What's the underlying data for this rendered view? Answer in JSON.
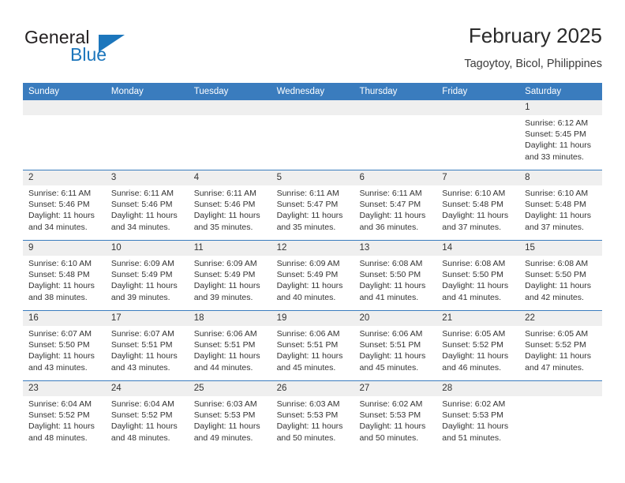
{
  "brand": {
    "name_part1": "General",
    "name_part2": "Blue",
    "accent_color": "#1c76bc",
    "logo_icon": "triangle-logo-icon"
  },
  "header": {
    "title": "February 2025",
    "location": "Tagoytoy, Bicol, Philippines"
  },
  "calendar": {
    "header_bg_color": "#3a7cbe",
    "daynum_band_color": "#efefef",
    "weekdays": [
      "Sunday",
      "Monday",
      "Tuesday",
      "Wednesday",
      "Thursday",
      "Friday",
      "Saturday"
    ],
    "weeks": [
      [
        {
          "day": "",
          "sunrise": "",
          "sunset": "",
          "daylight_line1": "",
          "daylight_line2": ""
        },
        {
          "day": "",
          "sunrise": "",
          "sunset": "",
          "daylight_line1": "",
          "daylight_line2": ""
        },
        {
          "day": "",
          "sunrise": "",
          "sunset": "",
          "daylight_line1": "",
          "daylight_line2": ""
        },
        {
          "day": "",
          "sunrise": "",
          "sunset": "",
          "daylight_line1": "",
          "daylight_line2": ""
        },
        {
          "day": "",
          "sunrise": "",
          "sunset": "",
          "daylight_line1": "",
          "daylight_line2": ""
        },
        {
          "day": "",
          "sunrise": "",
          "sunset": "",
          "daylight_line1": "",
          "daylight_line2": ""
        },
        {
          "day": "1",
          "sunrise": "Sunrise: 6:12 AM",
          "sunset": "Sunset: 5:45 PM",
          "daylight_line1": "Daylight: 11 hours",
          "daylight_line2": "and 33 minutes."
        }
      ],
      [
        {
          "day": "2",
          "sunrise": "Sunrise: 6:11 AM",
          "sunset": "Sunset: 5:46 PM",
          "daylight_line1": "Daylight: 11 hours",
          "daylight_line2": "and 34 minutes."
        },
        {
          "day": "3",
          "sunrise": "Sunrise: 6:11 AM",
          "sunset": "Sunset: 5:46 PM",
          "daylight_line1": "Daylight: 11 hours",
          "daylight_line2": "and 34 minutes."
        },
        {
          "day": "4",
          "sunrise": "Sunrise: 6:11 AM",
          "sunset": "Sunset: 5:46 PM",
          "daylight_line1": "Daylight: 11 hours",
          "daylight_line2": "and 35 minutes."
        },
        {
          "day": "5",
          "sunrise": "Sunrise: 6:11 AM",
          "sunset": "Sunset: 5:47 PM",
          "daylight_line1": "Daylight: 11 hours",
          "daylight_line2": "and 35 minutes."
        },
        {
          "day": "6",
          "sunrise": "Sunrise: 6:11 AM",
          "sunset": "Sunset: 5:47 PM",
          "daylight_line1": "Daylight: 11 hours",
          "daylight_line2": "and 36 minutes."
        },
        {
          "day": "7",
          "sunrise": "Sunrise: 6:10 AM",
          "sunset": "Sunset: 5:48 PM",
          "daylight_line1": "Daylight: 11 hours",
          "daylight_line2": "and 37 minutes."
        },
        {
          "day": "8",
          "sunrise": "Sunrise: 6:10 AM",
          "sunset": "Sunset: 5:48 PM",
          "daylight_line1": "Daylight: 11 hours",
          "daylight_line2": "and 37 minutes."
        }
      ],
      [
        {
          "day": "9",
          "sunrise": "Sunrise: 6:10 AM",
          "sunset": "Sunset: 5:48 PM",
          "daylight_line1": "Daylight: 11 hours",
          "daylight_line2": "and 38 minutes."
        },
        {
          "day": "10",
          "sunrise": "Sunrise: 6:09 AM",
          "sunset": "Sunset: 5:49 PM",
          "daylight_line1": "Daylight: 11 hours",
          "daylight_line2": "and 39 minutes."
        },
        {
          "day": "11",
          "sunrise": "Sunrise: 6:09 AM",
          "sunset": "Sunset: 5:49 PM",
          "daylight_line1": "Daylight: 11 hours",
          "daylight_line2": "and 39 minutes."
        },
        {
          "day": "12",
          "sunrise": "Sunrise: 6:09 AM",
          "sunset": "Sunset: 5:49 PM",
          "daylight_line1": "Daylight: 11 hours",
          "daylight_line2": "and 40 minutes."
        },
        {
          "day": "13",
          "sunrise": "Sunrise: 6:08 AM",
          "sunset": "Sunset: 5:50 PM",
          "daylight_line1": "Daylight: 11 hours",
          "daylight_line2": "and 41 minutes."
        },
        {
          "day": "14",
          "sunrise": "Sunrise: 6:08 AM",
          "sunset": "Sunset: 5:50 PM",
          "daylight_line1": "Daylight: 11 hours",
          "daylight_line2": "and 41 minutes."
        },
        {
          "day": "15",
          "sunrise": "Sunrise: 6:08 AM",
          "sunset": "Sunset: 5:50 PM",
          "daylight_line1": "Daylight: 11 hours",
          "daylight_line2": "and 42 minutes."
        }
      ],
      [
        {
          "day": "16",
          "sunrise": "Sunrise: 6:07 AM",
          "sunset": "Sunset: 5:50 PM",
          "daylight_line1": "Daylight: 11 hours",
          "daylight_line2": "and 43 minutes."
        },
        {
          "day": "17",
          "sunrise": "Sunrise: 6:07 AM",
          "sunset": "Sunset: 5:51 PM",
          "daylight_line1": "Daylight: 11 hours",
          "daylight_line2": "and 43 minutes."
        },
        {
          "day": "18",
          "sunrise": "Sunrise: 6:06 AM",
          "sunset": "Sunset: 5:51 PM",
          "daylight_line1": "Daylight: 11 hours",
          "daylight_line2": "and 44 minutes."
        },
        {
          "day": "19",
          "sunrise": "Sunrise: 6:06 AM",
          "sunset": "Sunset: 5:51 PM",
          "daylight_line1": "Daylight: 11 hours",
          "daylight_line2": "and 45 minutes."
        },
        {
          "day": "20",
          "sunrise": "Sunrise: 6:06 AM",
          "sunset": "Sunset: 5:51 PM",
          "daylight_line1": "Daylight: 11 hours",
          "daylight_line2": "and 45 minutes."
        },
        {
          "day": "21",
          "sunrise": "Sunrise: 6:05 AM",
          "sunset": "Sunset: 5:52 PM",
          "daylight_line1": "Daylight: 11 hours",
          "daylight_line2": "and 46 minutes."
        },
        {
          "day": "22",
          "sunrise": "Sunrise: 6:05 AM",
          "sunset": "Sunset: 5:52 PM",
          "daylight_line1": "Daylight: 11 hours",
          "daylight_line2": "and 47 minutes."
        }
      ],
      [
        {
          "day": "23",
          "sunrise": "Sunrise: 6:04 AM",
          "sunset": "Sunset: 5:52 PM",
          "daylight_line1": "Daylight: 11 hours",
          "daylight_line2": "and 48 minutes."
        },
        {
          "day": "24",
          "sunrise": "Sunrise: 6:04 AM",
          "sunset": "Sunset: 5:52 PM",
          "daylight_line1": "Daylight: 11 hours",
          "daylight_line2": "and 48 minutes."
        },
        {
          "day": "25",
          "sunrise": "Sunrise: 6:03 AM",
          "sunset": "Sunset: 5:53 PM",
          "daylight_line1": "Daylight: 11 hours",
          "daylight_line2": "and 49 minutes."
        },
        {
          "day": "26",
          "sunrise": "Sunrise: 6:03 AM",
          "sunset": "Sunset: 5:53 PM",
          "daylight_line1": "Daylight: 11 hours",
          "daylight_line2": "and 50 minutes."
        },
        {
          "day": "27",
          "sunrise": "Sunrise: 6:02 AM",
          "sunset": "Sunset: 5:53 PM",
          "daylight_line1": "Daylight: 11 hours",
          "daylight_line2": "and 50 minutes."
        },
        {
          "day": "28",
          "sunrise": "Sunrise: 6:02 AM",
          "sunset": "Sunset: 5:53 PM",
          "daylight_line1": "Daylight: 11 hours",
          "daylight_line2": "and 51 minutes."
        },
        {
          "day": "",
          "sunrise": "",
          "sunset": "",
          "daylight_line1": "",
          "daylight_line2": ""
        }
      ]
    ]
  }
}
